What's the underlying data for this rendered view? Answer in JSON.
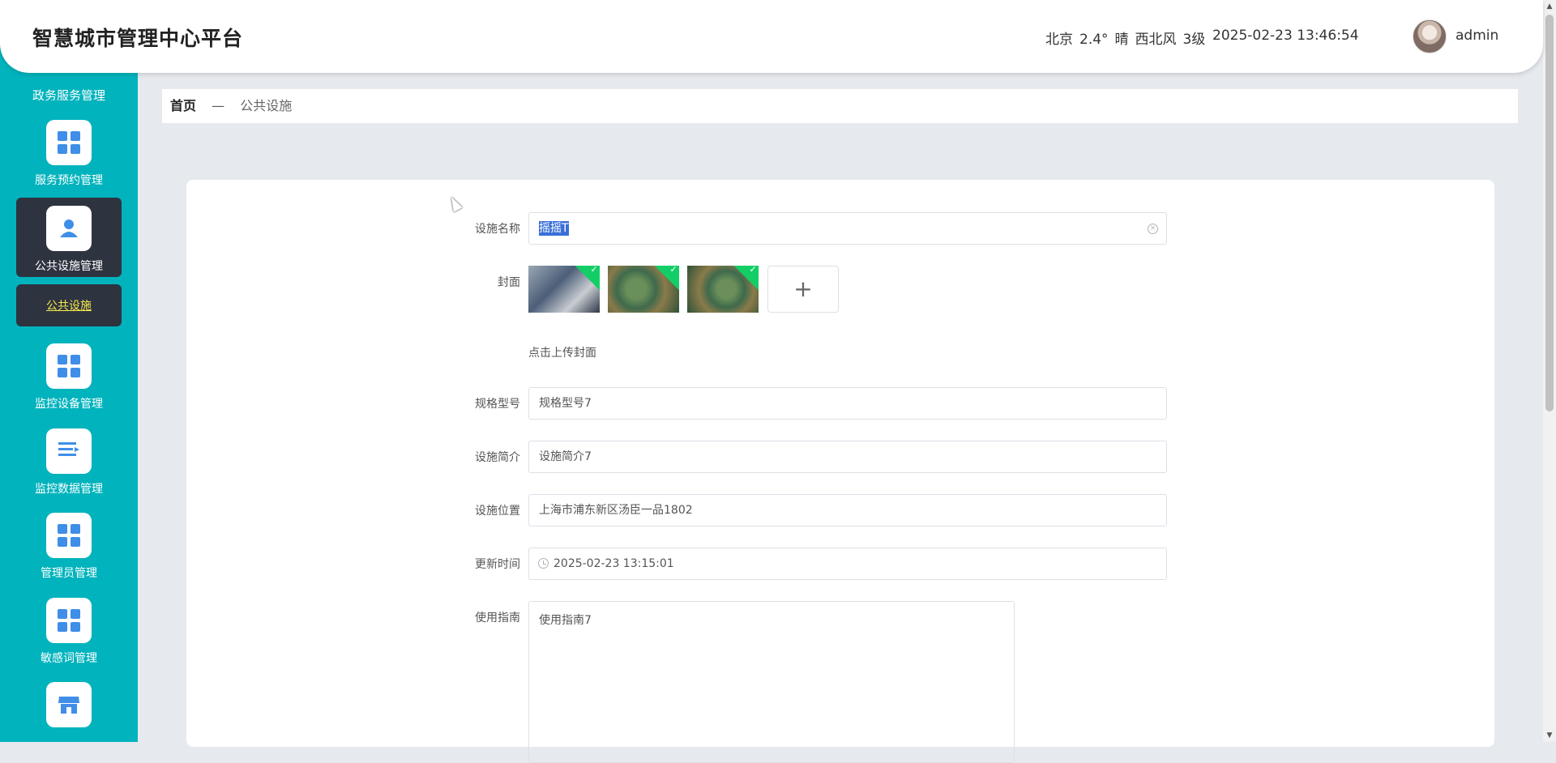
{
  "header": {
    "title": "智慧城市管理中心平台",
    "weather": {
      "city": "北京",
      "temp": "2.4°",
      "condition": "晴",
      "wind": "西北风",
      "level": "3级"
    },
    "datetime": "2025-02-23 13:46:54",
    "username": "admin"
  },
  "sidebar": {
    "cut_label": "政务服务管理",
    "items": [
      {
        "label": "服务预约管理",
        "icon": "grid-icon"
      },
      {
        "label": "公共设施管理",
        "icon": "user-icon"
      },
      {
        "label": "监控设备管理",
        "icon": "grid-icon"
      },
      {
        "label": "监控数据管理",
        "icon": "list-icon"
      },
      {
        "label": "管理员管理",
        "icon": "grid-icon"
      },
      {
        "label": "敏感词管理",
        "icon": "grid-icon"
      },
      {
        "label": "",
        "icon": "shop-icon"
      }
    ],
    "submenu": "公共设施"
  },
  "breadcrumb": {
    "home": "首页",
    "separator": "—",
    "current": "公共设施"
  },
  "form": {
    "name": {
      "label": "设施名称",
      "value": "摇摇T"
    },
    "cover": {
      "label": "封面",
      "hint": "点击上传封面",
      "plus": "+"
    },
    "spec": {
      "label": "规格型号",
      "value": "规格型号7"
    },
    "intro": {
      "label": "设施简介",
      "value": "设施简介7"
    },
    "location": {
      "label": "设施位置",
      "value": "上海市浦东新区汤臣一品1802"
    },
    "updated": {
      "label": "更新时间",
      "value": "2025-02-23 13:15:01"
    },
    "guide": {
      "label": "使用指南",
      "value": "使用指南7"
    }
  },
  "colors": {
    "sidebar": "#00b3bd",
    "active": "#2e3340",
    "icon": "#3f8ee8",
    "submenu_text": "#f7e94a"
  }
}
